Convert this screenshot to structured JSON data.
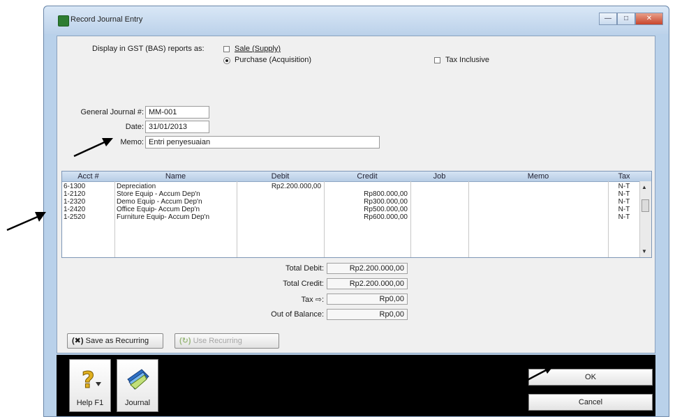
{
  "window": {
    "title": "Record Journal Entry"
  },
  "gst": {
    "label": "Display in GST (BAS) reports as:",
    "sale": "Sale (Supply)",
    "purchase": "Purchase (Acquisition)",
    "tax_inclusive": "Tax Inclusive"
  },
  "form": {
    "journal_label": "General Journal #:",
    "journal_value": "MM-001",
    "date_label": "Date:",
    "date_value": "31/01/2013",
    "memo_label": "Memo:",
    "memo_value": "Entri penyesuaian"
  },
  "grid": {
    "headers": [
      "Acct #",
      "Name",
      "Debit",
      "Credit",
      "Job",
      "Memo",
      "Tax"
    ],
    "rows": [
      {
        "acct": "6-1300",
        "name": "Depreciation",
        "debit": "Rp2.200.000,00",
        "credit": "",
        "job": "",
        "memo": "",
        "tax": "N-T"
      },
      {
        "acct": "1-2120",
        "name": "Store Equip - Accum Dep'n",
        "debit": "",
        "credit": "Rp800.000,00",
        "job": "",
        "memo": "",
        "tax": "N-T"
      },
      {
        "acct": "1-2320",
        "name": "Demo Equip - Accum Dep'n",
        "debit": "",
        "credit": "Rp300.000,00",
        "job": "",
        "memo": "",
        "tax": "N-T"
      },
      {
        "acct": "1-2420",
        "name": "Office Equip- Accum Dep'n",
        "debit": "",
        "credit": "Rp500.000,00",
        "job": "",
        "memo": "",
        "tax": "N-T"
      },
      {
        "acct": "1-2520",
        "name": "Furniture Equip- Accum Dep'n",
        "debit": "",
        "credit": "Rp600.000,00",
        "job": "",
        "memo": "",
        "tax": "N-T"
      }
    ]
  },
  "totals": {
    "debit_label": "Total Debit:",
    "debit_value": "Rp2.200.000,00",
    "credit_label": "Total Credit:",
    "credit_value": "Rp2.200.000,00",
    "tax_label": "Tax ⇨:",
    "tax_value": "Rp0,00",
    "oob_label": "Out of Balance:",
    "oob_value": "Rp0,00"
  },
  "buttons": {
    "save_recurring": "Save as Recurring",
    "use_recurring": "Use Recurring",
    "help": "Help F1",
    "journal": "Journal",
    "ok": "OK",
    "cancel": "Cancel"
  },
  "colors": {
    "titlebar": "#bcd2ea",
    "close": "#c8452b",
    "bottombar": "#000000"
  }
}
